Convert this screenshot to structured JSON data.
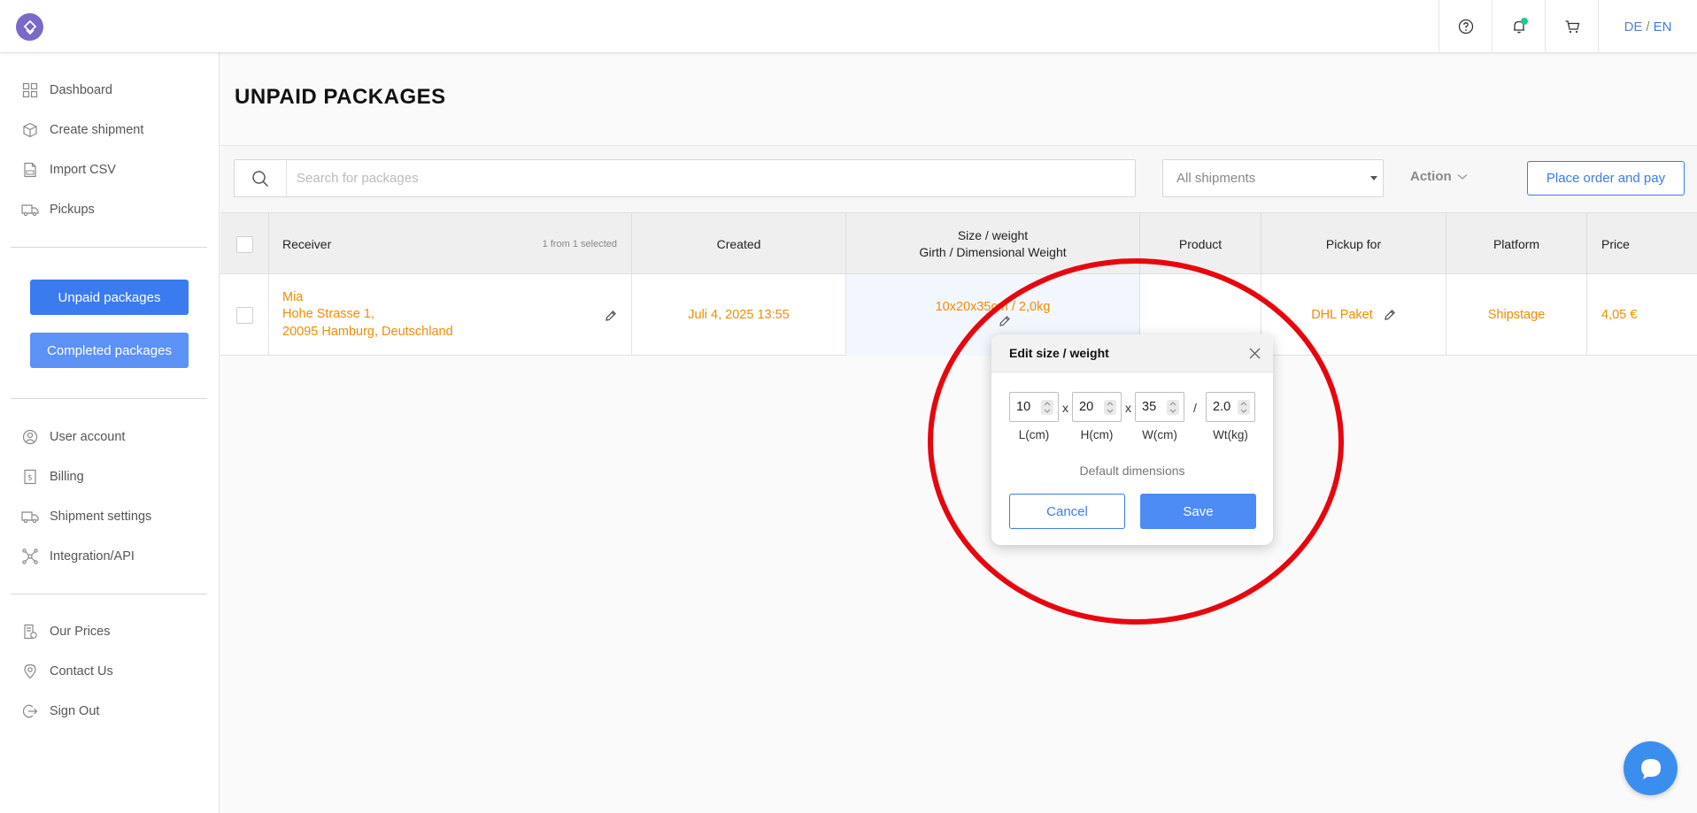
{
  "header": {
    "lang_de": "DE",
    "lang_sep": "/",
    "lang_en": "EN",
    "icons": [
      "help-icon",
      "bell-icon",
      "cart-icon"
    ]
  },
  "sidebar": {
    "items_top": [
      {
        "label": "Dashboard",
        "icon": "grid-icon"
      },
      {
        "label": "Create shipment",
        "icon": "box-icon"
      },
      {
        "label": "Import CSV",
        "icon": "csv-file-icon"
      },
      {
        "label": "Pickups",
        "icon": "truck-icon"
      }
    ],
    "unpaid_button": "Unpaid packages",
    "completed_button": "Completed packages",
    "items_mid": [
      {
        "label": "User account",
        "icon": "user-icon"
      },
      {
        "label": "Billing",
        "icon": "billing-icon"
      },
      {
        "label": "Shipment settings",
        "icon": "truck-settings-icon"
      },
      {
        "label": "Integration/API",
        "icon": "network-icon"
      }
    ],
    "items_bottom": [
      {
        "label": "Our Prices",
        "icon": "price-list-icon"
      },
      {
        "label": "Contact Us",
        "icon": "location-pin-icon"
      },
      {
        "label": "Sign Out",
        "icon": "sign-out-icon"
      }
    ]
  },
  "main": {
    "title": "UNPAID PACKAGES",
    "search_placeholder": "Search for packages",
    "filter_select": "All shipments",
    "action_label": "Action",
    "place_order_button": "Place order and pay"
  },
  "table": {
    "headers": {
      "receiver": "Receiver",
      "selection_count": "1 from 1 selected",
      "created": "Created",
      "size_weight_line1": "Size / weight",
      "size_weight_line2": "Girth / Dimensional Weight",
      "product": "Product",
      "pickup_for": "Pickup for",
      "platform": "Platform",
      "price": "Price"
    },
    "rows": [
      {
        "receiver_name": "Mia",
        "receiver_street": "Hohe Strasse 1,",
        "receiver_city": "20095 Hamburg, Deutschland",
        "created": "Juli 4, 2025 13:55",
        "size_weight": "10x20x35cm / 2,0kg",
        "product": "",
        "pickup_for": "DHL Paket",
        "platform": "Shipstage",
        "price": "4,05 €"
      }
    ]
  },
  "popup": {
    "title": "Edit size / weight",
    "length": "10",
    "height": "20",
    "width": "35",
    "weight": "2.0",
    "label_l": "L(cm)",
    "label_h": "H(cm)",
    "label_w": "W(cm)",
    "label_wt": "Wt(kg)",
    "sep_x": "x",
    "sep_slash": "/",
    "default_dimensions": "Default dimensions",
    "cancel": "Cancel",
    "save": "Save"
  },
  "colors": {
    "accent": "#3a7bf0",
    "orange": "#f28c00",
    "annotation": "#e8060e",
    "logo": "#7b68c9"
  }
}
